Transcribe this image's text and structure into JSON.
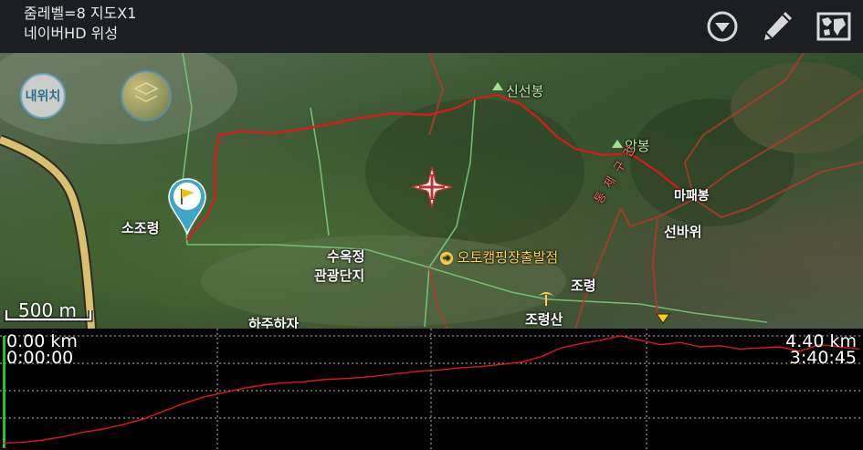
{
  "header": {
    "zoom_line": "줌레벨=8 지도X1",
    "source_line": "네이버HD 위성",
    "icons": [
      "dropdown-circle-icon",
      "pencil-icon",
      "map-image-icon"
    ]
  },
  "map": {
    "my_location_label": "내위치",
    "scale_label": "500 m",
    "place_labels": {
      "sojoryeong": "소조령",
      "suokjeong": "수옥정",
      "gwangwang": "관광단지",
      "sinseonbong": "신선봉",
      "ambong": "암봉",
      "mapaebong": "마패봉",
      "seonbawi": "선바위",
      "jeoryeong": "조령",
      "jeoryeongsan": "조령산",
      "camping": "오토캠핑장출발점",
      "hanjuhanja": "하주하자",
      "boundary_text": "통제구간"
    }
  },
  "profile": {
    "start_distance": "0.00 km",
    "start_time": "0:00:00",
    "end_distance": "4.40 km",
    "end_time": "3:40:45",
    "line_color": "#e01818",
    "elevation_samples": [
      0.02,
      0.03,
      0.05,
      0.08,
      0.12,
      0.15,
      0.19,
      0.24,
      0.31,
      0.38,
      0.44,
      0.48,
      0.52,
      0.55,
      0.57,
      0.58,
      0.6,
      0.61,
      0.62,
      0.64,
      0.66,
      0.68,
      0.69,
      0.71,
      0.72,
      0.74,
      0.76,
      0.81,
      0.89,
      0.93,
      0.96,
      1.0,
      0.96,
      0.92,
      0.94,
      0.9,
      0.91,
      0.88,
      0.89,
      0.9,
      0.86,
      0.92,
      0.9,
      0.88
    ]
  }
}
